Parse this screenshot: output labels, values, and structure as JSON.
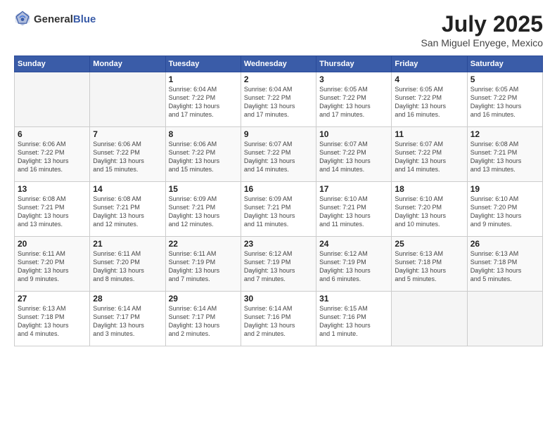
{
  "logo": {
    "general": "General",
    "blue": "Blue"
  },
  "header": {
    "month": "July 2025",
    "location": "San Miguel Enyege, Mexico"
  },
  "weekdays": [
    "Sunday",
    "Monday",
    "Tuesday",
    "Wednesday",
    "Thursday",
    "Friday",
    "Saturday"
  ],
  "weeks": [
    [
      {
        "day": "",
        "info": ""
      },
      {
        "day": "",
        "info": ""
      },
      {
        "day": "1",
        "info": "Sunrise: 6:04 AM\nSunset: 7:22 PM\nDaylight: 13 hours\nand 17 minutes."
      },
      {
        "day": "2",
        "info": "Sunrise: 6:04 AM\nSunset: 7:22 PM\nDaylight: 13 hours\nand 17 minutes."
      },
      {
        "day": "3",
        "info": "Sunrise: 6:05 AM\nSunset: 7:22 PM\nDaylight: 13 hours\nand 17 minutes."
      },
      {
        "day": "4",
        "info": "Sunrise: 6:05 AM\nSunset: 7:22 PM\nDaylight: 13 hours\nand 16 minutes."
      },
      {
        "day": "5",
        "info": "Sunrise: 6:05 AM\nSunset: 7:22 PM\nDaylight: 13 hours\nand 16 minutes."
      }
    ],
    [
      {
        "day": "6",
        "info": "Sunrise: 6:06 AM\nSunset: 7:22 PM\nDaylight: 13 hours\nand 16 minutes."
      },
      {
        "day": "7",
        "info": "Sunrise: 6:06 AM\nSunset: 7:22 PM\nDaylight: 13 hours\nand 15 minutes."
      },
      {
        "day": "8",
        "info": "Sunrise: 6:06 AM\nSunset: 7:22 PM\nDaylight: 13 hours\nand 15 minutes."
      },
      {
        "day": "9",
        "info": "Sunrise: 6:07 AM\nSunset: 7:22 PM\nDaylight: 13 hours\nand 14 minutes."
      },
      {
        "day": "10",
        "info": "Sunrise: 6:07 AM\nSunset: 7:22 PM\nDaylight: 13 hours\nand 14 minutes."
      },
      {
        "day": "11",
        "info": "Sunrise: 6:07 AM\nSunset: 7:22 PM\nDaylight: 13 hours\nand 14 minutes."
      },
      {
        "day": "12",
        "info": "Sunrise: 6:08 AM\nSunset: 7:21 PM\nDaylight: 13 hours\nand 13 minutes."
      }
    ],
    [
      {
        "day": "13",
        "info": "Sunrise: 6:08 AM\nSunset: 7:21 PM\nDaylight: 13 hours\nand 13 minutes."
      },
      {
        "day": "14",
        "info": "Sunrise: 6:08 AM\nSunset: 7:21 PM\nDaylight: 13 hours\nand 12 minutes."
      },
      {
        "day": "15",
        "info": "Sunrise: 6:09 AM\nSunset: 7:21 PM\nDaylight: 13 hours\nand 12 minutes."
      },
      {
        "day": "16",
        "info": "Sunrise: 6:09 AM\nSunset: 7:21 PM\nDaylight: 13 hours\nand 11 minutes."
      },
      {
        "day": "17",
        "info": "Sunrise: 6:10 AM\nSunset: 7:21 PM\nDaylight: 13 hours\nand 11 minutes."
      },
      {
        "day": "18",
        "info": "Sunrise: 6:10 AM\nSunset: 7:20 PM\nDaylight: 13 hours\nand 10 minutes."
      },
      {
        "day": "19",
        "info": "Sunrise: 6:10 AM\nSunset: 7:20 PM\nDaylight: 13 hours\nand 9 minutes."
      }
    ],
    [
      {
        "day": "20",
        "info": "Sunrise: 6:11 AM\nSunset: 7:20 PM\nDaylight: 13 hours\nand 9 minutes."
      },
      {
        "day": "21",
        "info": "Sunrise: 6:11 AM\nSunset: 7:20 PM\nDaylight: 13 hours\nand 8 minutes."
      },
      {
        "day": "22",
        "info": "Sunrise: 6:11 AM\nSunset: 7:19 PM\nDaylight: 13 hours\nand 7 minutes."
      },
      {
        "day": "23",
        "info": "Sunrise: 6:12 AM\nSunset: 7:19 PM\nDaylight: 13 hours\nand 7 minutes."
      },
      {
        "day": "24",
        "info": "Sunrise: 6:12 AM\nSunset: 7:19 PM\nDaylight: 13 hours\nand 6 minutes."
      },
      {
        "day": "25",
        "info": "Sunrise: 6:13 AM\nSunset: 7:18 PM\nDaylight: 13 hours\nand 5 minutes."
      },
      {
        "day": "26",
        "info": "Sunrise: 6:13 AM\nSunset: 7:18 PM\nDaylight: 13 hours\nand 5 minutes."
      }
    ],
    [
      {
        "day": "27",
        "info": "Sunrise: 6:13 AM\nSunset: 7:18 PM\nDaylight: 13 hours\nand 4 minutes."
      },
      {
        "day": "28",
        "info": "Sunrise: 6:14 AM\nSunset: 7:17 PM\nDaylight: 13 hours\nand 3 minutes."
      },
      {
        "day": "29",
        "info": "Sunrise: 6:14 AM\nSunset: 7:17 PM\nDaylight: 13 hours\nand 2 minutes."
      },
      {
        "day": "30",
        "info": "Sunrise: 6:14 AM\nSunset: 7:16 PM\nDaylight: 13 hours\nand 2 minutes."
      },
      {
        "day": "31",
        "info": "Sunrise: 6:15 AM\nSunset: 7:16 PM\nDaylight: 13 hours\nand 1 minute."
      },
      {
        "day": "",
        "info": ""
      },
      {
        "day": "",
        "info": ""
      }
    ]
  ]
}
